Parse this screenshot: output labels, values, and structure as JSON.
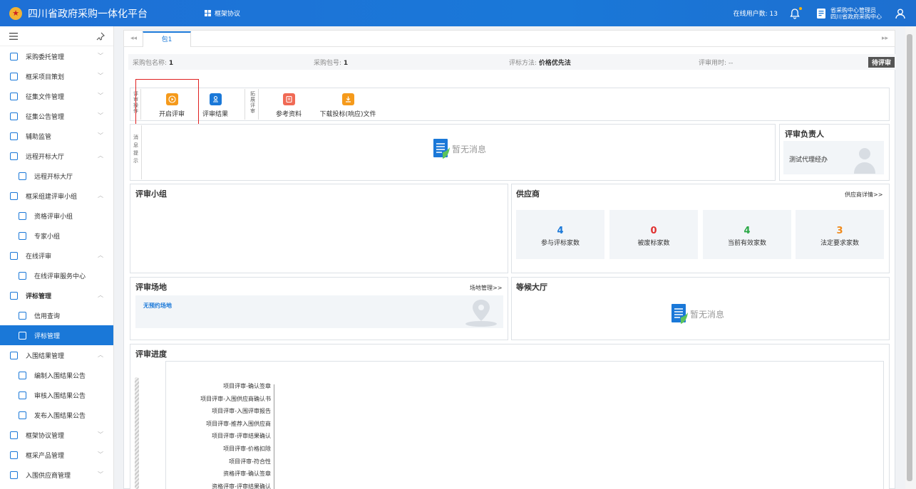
{
  "app": {
    "title": "四川省政府采购一体化平台",
    "menu": "框架协议"
  },
  "header": {
    "online_label": "在线用户数: 13",
    "user_line1": "省采购中心管理员",
    "user_line2": "四川省政府采购中心"
  },
  "sidebar": {
    "items": [
      {
        "label": "采购委托管理",
        "arrow": "﹀",
        "sub": false
      },
      {
        "label": "框采项目策划",
        "arrow": "﹀",
        "sub": false
      },
      {
        "label": "征集文件管理",
        "arrow": "﹀",
        "sub": false
      },
      {
        "label": "征集公告管理",
        "arrow": "﹀",
        "sub": false
      },
      {
        "label": "辅助监管",
        "arrow": "﹀",
        "sub": false
      },
      {
        "label": "远程开标大厅",
        "arrow": "︿",
        "sub": false
      },
      {
        "label": "远程开标大厅",
        "arrow": "",
        "sub": true
      },
      {
        "label": "框采组建评审小组",
        "arrow": "︿",
        "sub": false
      },
      {
        "label": "资格评审小组",
        "arrow": "",
        "sub": true
      },
      {
        "label": "专家小组",
        "arrow": "",
        "sub": true
      },
      {
        "label": "在线评审",
        "arrow": "︿",
        "sub": false
      },
      {
        "label": "在线评审服务中心",
        "arrow": "",
        "sub": true
      },
      {
        "label": "评标管理",
        "arrow": "︿",
        "sub": false,
        "bold": true
      },
      {
        "label": "信用查询",
        "arrow": "",
        "sub": true
      },
      {
        "label": "评标管理",
        "arrow": "",
        "sub": true,
        "active": true
      },
      {
        "label": "入围结果管理",
        "arrow": "︿",
        "sub": false
      },
      {
        "label": "编制入围结果公告",
        "arrow": "",
        "sub": true
      },
      {
        "label": "审核入围结果公告",
        "arrow": "",
        "sub": true
      },
      {
        "label": "发布入围结果公告",
        "arrow": "",
        "sub": true
      },
      {
        "label": "框架协议管理",
        "arrow": "﹀",
        "sub": false
      },
      {
        "label": "框采产品管理",
        "arrow": "﹀",
        "sub": false
      },
      {
        "label": "入围供应商管理",
        "arrow": "﹀",
        "sub": false
      }
    ]
  },
  "tabs": {
    "active": "包1"
  },
  "info": {
    "pkg_name_label": "采购包名称:",
    "pkg_name": "1",
    "pkg_no_label": "采购包号:",
    "pkg_no": "1",
    "method_label": "评标方法:",
    "method": "价格优先法",
    "time_label": "评审用时:",
    "time": "--",
    "status": "待评审"
  },
  "toolbar": {
    "group1_label": "评审操作",
    "group2_label": "拓展评审",
    "start": "开启评审",
    "result": "评审结果",
    "ref": "参考资料",
    "download": "下载投标(响应)文件"
  },
  "message": {
    "label": "消息提示",
    "empty": "暂无消息"
  },
  "leader": {
    "title": "评审负责人",
    "name": "测试代理经办"
  },
  "panel": {
    "title": "评审小组"
  },
  "supplier": {
    "title": "供应商",
    "more": "供应商详情>>",
    "stats": [
      {
        "value": "4",
        "label": "参与评标家数",
        "color": "#1a78d8"
      },
      {
        "value": "0",
        "label": "被废标家数",
        "color": "#e03030"
      },
      {
        "value": "4",
        "label": "当前有效家数",
        "color": "#2aa845"
      },
      {
        "value": "3",
        "label": "法定要求家数",
        "color": "#f08a1c"
      }
    ]
  },
  "venue": {
    "title": "评审场地",
    "more": "场地管理>>",
    "empty": "无预约场地"
  },
  "lobby": {
    "title": "等候大厅",
    "empty": "暂无消息"
  },
  "progress": {
    "title": "评审进度",
    "steps": [
      "项目评审-确认签章",
      "项目评审-入围供应商确认书",
      "项目评审-入围评审报告",
      "项目评审-推荐入围供应商",
      "项目评审-评审结果确认",
      "项目评审-价格扣除",
      "项目评审-符合性",
      "资格评审-确认签章",
      "资格评审-评审结果确认"
    ]
  }
}
